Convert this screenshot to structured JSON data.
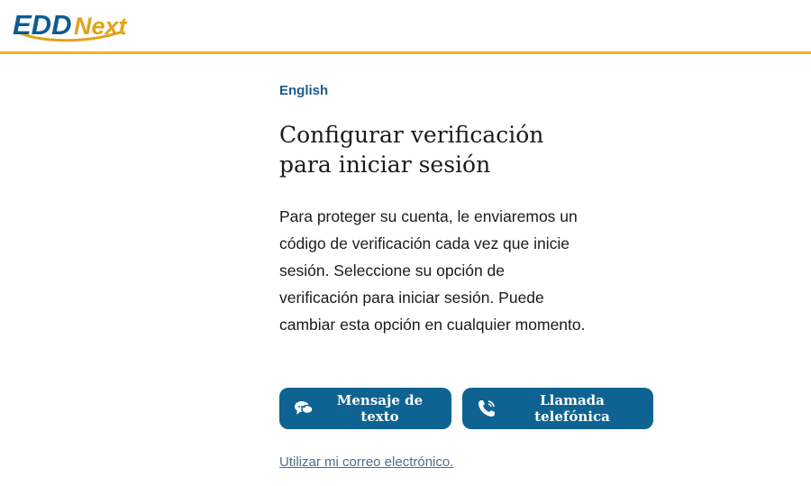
{
  "header": {
    "logo_text_primary": "EDD",
    "logo_text_secondary": "Next",
    "brand_primary_color": "#0e5c8f",
    "brand_accent_color": "#e2a21a"
  },
  "main": {
    "language_link": "English",
    "title": "Configurar verificación para iniciar sesión",
    "description": "Para proteger su cuenta, le enviaremos un código de verificación cada vez que inicie sesión. Seleccione su opción de verificación para iniciar sesión. Puede cambiar esta opción en cualquier momento.",
    "buttons": {
      "text_message": {
        "label": "Mensaje de texto",
        "icon": "chat-bubbles-icon"
      },
      "phone_call": {
        "label": "Llamada telefónica",
        "icon": "phone-icon"
      }
    },
    "email_link": "Utilizar mi correo electrónico."
  },
  "colors": {
    "header_border": "#f2b51c",
    "button_bg": "#0e6392",
    "link": "#1f5b8c"
  }
}
